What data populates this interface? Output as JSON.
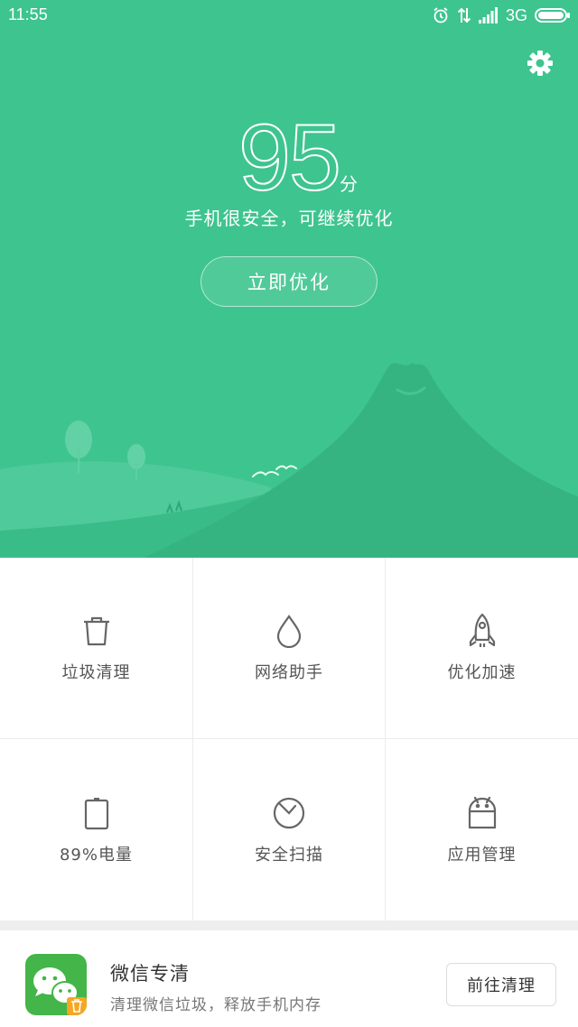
{
  "status_bar": {
    "time": "11:55",
    "network": "3G",
    "icons": [
      "alarm-icon",
      "data-arrows-icon",
      "signal-icon",
      "battery-icon"
    ]
  },
  "header": {
    "settings_icon": "gear-icon",
    "score": "95",
    "score_unit": "分",
    "description": "手机很安全，可继续优化",
    "optimize_button": "立即优化",
    "background_color": "#3ec48f"
  },
  "tools": [
    {
      "icon": "trash-icon",
      "label": "垃圾清理"
    },
    {
      "icon": "water-drop-icon",
      "label": "网络助手"
    },
    {
      "icon": "rocket-icon",
      "label": "优化加速"
    },
    {
      "icon": "battery-icon",
      "label": "89%电量",
      "level_percent": 89
    },
    {
      "icon": "scan-icon",
      "label": "安全扫描"
    },
    {
      "icon": "android-icon",
      "label": "应用管理"
    }
  ],
  "promo_card": {
    "app_icon": "wechat-clean-icon",
    "title": "微信专清",
    "subtitle": "清理微信垃圾，释放手机内存",
    "button": "前往清理"
  }
}
